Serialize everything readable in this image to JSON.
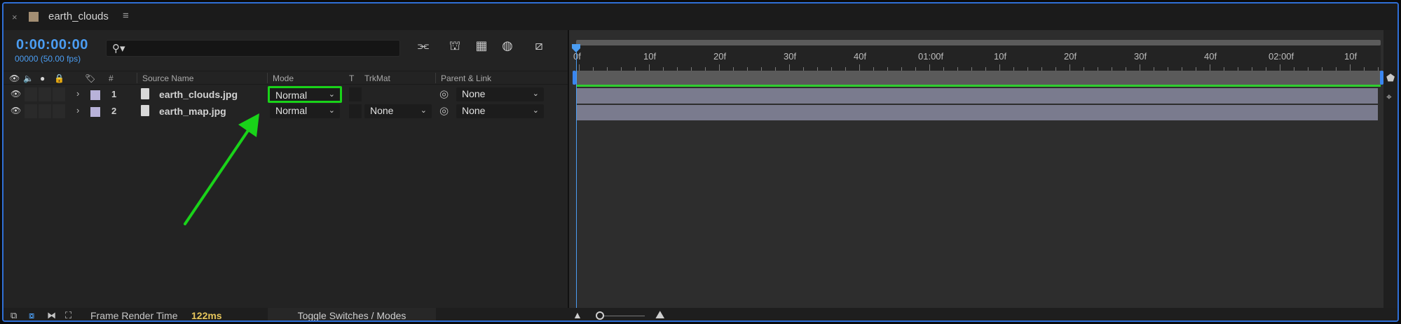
{
  "tab": {
    "close": "×",
    "title": "earth_clouds",
    "menu": "≡"
  },
  "header": {
    "timecode": "0:00:00:00",
    "framecount": "00000 (50.00 fps)",
    "search_placeholder": ""
  },
  "columns": {
    "hash": "#",
    "source_name": "Source Name",
    "mode": "Mode",
    "t": "T",
    "trkmat": "TrkMat",
    "parent": "Parent & Link"
  },
  "layers": [
    {
      "num": "1",
      "name": "earth_clouds.jpg",
      "mode": "Normal",
      "trkmat": "",
      "parent": "None"
    },
    {
      "num": "2",
      "name": "earth_map.jpg",
      "mode": "Normal",
      "trkmat": "None",
      "parent": "None"
    }
  ],
  "ruler": {
    "labels": [
      "0f",
      "10f",
      "20f",
      "30f",
      "40f",
      "01:00f",
      "10f",
      "20f",
      "30f",
      "40f",
      "02:00f",
      "10f"
    ]
  },
  "footer": {
    "frame_render_label": "Frame Render Time",
    "frame_render_value": "122ms",
    "toggle_label": "Toggle Switches / Modes"
  },
  "colors": {
    "accent": "#4b9df2",
    "highlight": "#19d319",
    "label_swatch": "#b8b2d9",
    "render_time": "#e7c65b"
  },
  "icons": [
    "close-icon",
    "menu-icon",
    "search-icon",
    "comp-flowchart-icon",
    "shy-icon",
    "frame-blend-icon",
    "motion-blur-icon",
    "graph-editor-icon",
    "eye-icon",
    "audio-icon",
    "solo-icon",
    "lock-icon",
    "label-icon",
    "file-icon",
    "pickwhip-icon",
    "chevron-down-icon"
  ]
}
